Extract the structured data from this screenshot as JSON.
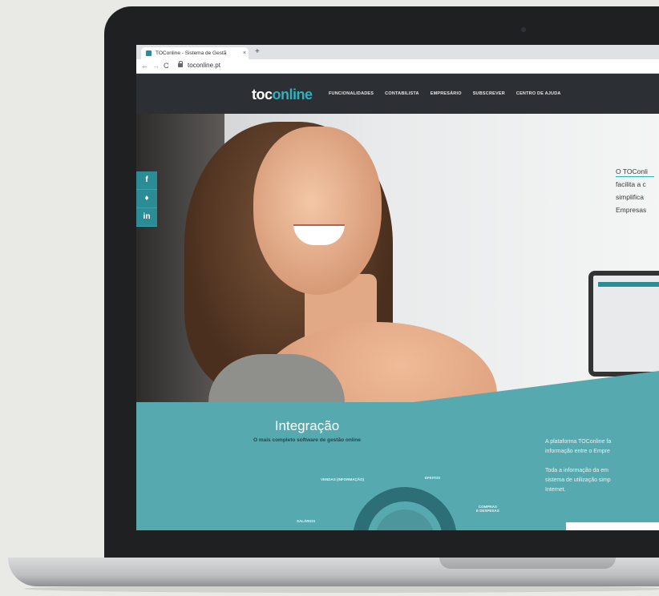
{
  "browser": {
    "tab_title": "TOConline - Sistema de Gestã",
    "tab_close": "×",
    "new_tab": "+",
    "back": "←",
    "forward": "→",
    "reload": "C",
    "address": "toconline.pt"
  },
  "site": {
    "logo_prefix": "toc",
    "logo_suffix": "online",
    "nav": [
      "FUNCIONALIDADES",
      "CONTABILISTA",
      "EMPRESÁRIO",
      "SUBSCREVER",
      "CENTRO DE AJUDA"
    ],
    "hero_lines": [
      "O TOConli",
      "facilita a c",
      "simplifica",
      "Empresas"
    ],
    "social": [
      {
        "icon": "facebook-icon",
        "glyph": "f"
      },
      {
        "icon": "twitter-icon",
        "glyph": "🐦"
      },
      {
        "icon": "linkedin-icon",
        "glyph": "in"
      }
    ],
    "integration": {
      "title": "Integração",
      "subtitle": "O mais completo software de gestão online",
      "labels": {
        "info": "VENDAS (INFORMAÇÃO)",
        "efetivos": "EFEITOS",
        "compras": "COMPRAS\nE DESPESAS",
        "salarios": "SALÁRIOS"
      }
    },
    "right_copy": [
      "A plataforma TOConline fa",
      "informação entre o Empre",
      "",
      "Toda a informação da em",
      "sistema de utilização simp",
      "Internet."
    ]
  },
  "colors": {
    "brand_teal": "#2bb3bf",
    "header_dark": "#2c2f33",
    "section_teal": "#57a9b0",
    "social_teal": "#2c8c95"
  }
}
